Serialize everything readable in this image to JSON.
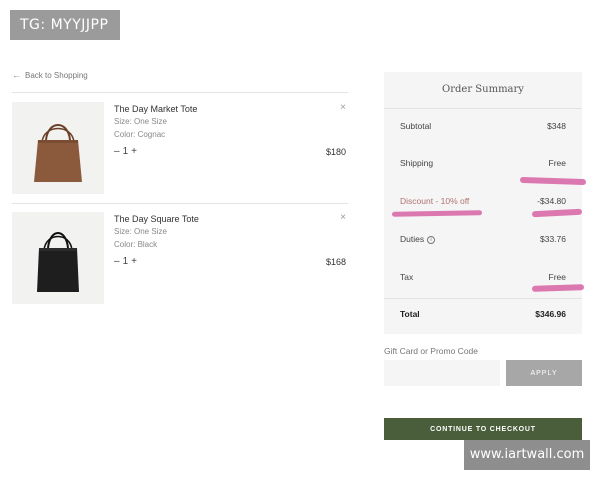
{
  "watermarks": {
    "top": "TG: MYYJJPP",
    "bottom": "www.iartwall.com"
  },
  "nav": {
    "back_label": "Back to Shopping"
  },
  "cart": {
    "items": [
      {
        "name": "The Day Market Tote",
        "size": "Size: One Size",
        "color": "Color: Cognac",
        "qty": "1",
        "price": "$180",
        "bag_color": "#8b5a3c",
        "handle_color": "#6b4028"
      },
      {
        "name": "The Day Square Tote",
        "size": "Size: One Size",
        "color": "Color: Black",
        "qty": "1",
        "price": "$168",
        "bag_color": "#1e1e1e",
        "handle_color": "#111111"
      }
    ],
    "qty_minus": "–",
    "qty_plus": "+",
    "remove_symbol": "×"
  },
  "summary": {
    "title": "Order Summary",
    "subtotal_label": "Subtotal",
    "subtotal_value": "$348",
    "shipping_label": "Shipping",
    "shipping_value": "Free",
    "discount_label": "Discount - 10% off",
    "discount_value": "-$34.80",
    "duties_label": "Duties",
    "duties_value": "$33.76",
    "tax_label": "Tax",
    "tax_value": "Free",
    "total_label": "Total",
    "total_value": "$346.96"
  },
  "promo": {
    "label": "Gift Card or Promo Code",
    "placeholder": "",
    "apply_label": "APPLY"
  },
  "checkout": {
    "label": "CONTINUE TO CHECKOUT"
  },
  "colors": {
    "checkout_green": "#4a5e3c",
    "scribble_pink": "#d96aa9"
  }
}
